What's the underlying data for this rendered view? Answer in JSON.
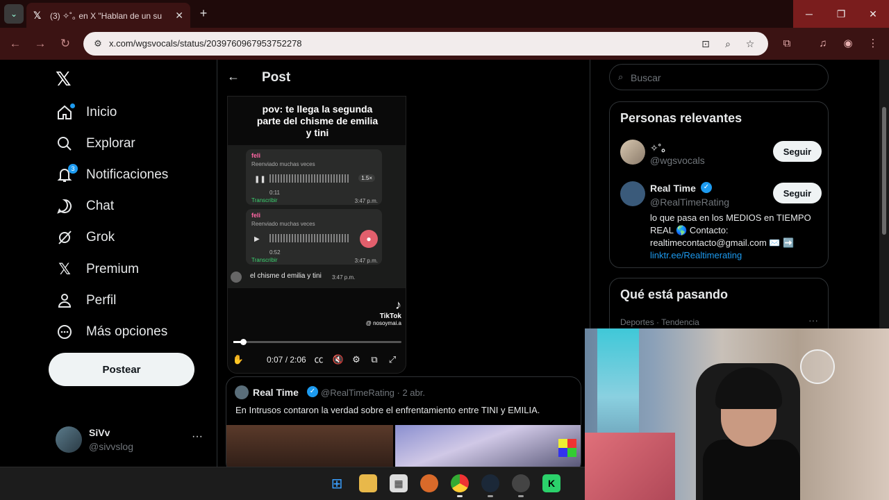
{
  "browser": {
    "tab_title": "(3) ✧˚｡ en X \"Hablan de un su",
    "url": "x.com/wgsvocals/status/2039760967953752278"
  },
  "nav": {
    "items": [
      {
        "label": "Inicio",
        "icon": "home-icon"
      },
      {
        "label": "Explorar",
        "icon": "search-icon"
      },
      {
        "label": "Notificaciones",
        "icon": "bell-icon",
        "badge": "3"
      },
      {
        "label": "Chat",
        "icon": "chat-icon"
      },
      {
        "label": "Grok",
        "icon": "grok-icon"
      },
      {
        "label": "Premium",
        "icon": "x-icon"
      },
      {
        "label": "Perfil",
        "icon": "person-icon"
      },
      {
        "label": "Más opciones",
        "icon": "more-circle-icon"
      }
    ],
    "post_button": "Postear",
    "account": {
      "name": "SiVv",
      "handle": "@sivvslog"
    }
  },
  "post": {
    "header_title": "Post",
    "video": {
      "caption": "pov: te llega la segunda parte del chisme de emilia y tini",
      "messages": [
        {
          "sender": "feli",
          "forwarded": "Reenviado muchas veces",
          "duration": "0:11",
          "speed": "1.5×",
          "transcribe": "Transcribir",
          "time": "3:47 p.m."
        },
        {
          "sender": "feli",
          "forwarded": "Reenviado muchas veces",
          "duration": "0:52",
          "transcribe": "Transcribir",
          "time": "3:47 p.m."
        }
      ],
      "last_message": {
        "text": "el chisme d emilia y tini",
        "time": "3:47 p.m."
      },
      "tiktok_label": "TikTok",
      "tiktok_user": "@ nosoymai.a",
      "time_display": "0:07 / 2:06",
      "progress": 0.056
    },
    "quote": {
      "name": "Real Time",
      "handle_date": "@RealTimeRating · 2 abr.",
      "text": "En Intrusos contaron la verdad sobre el enfrentamiento entre TINI y EMILIA."
    }
  },
  "sidebar": {
    "search_placeholder": "Buscar",
    "relevant_title": "Personas relevantes",
    "people": [
      {
        "name": "✧˚｡",
        "handle": "@wgsvocals",
        "follow": "Seguir"
      },
      {
        "name": "Real Time",
        "handle": "@RealTimeRating",
        "follow": "Seguir",
        "bio": "lo que pasa en los MEDIOS en TIEMPO REAL 🌎 Contacto: realtimecontacto@gmail.com ✉️ ➡️",
        "link": "linktr.ee/Realtimerating"
      }
    ],
    "trending_title": "Qué está pasando",
    "trend_meta": "Deportes · Tendencia"
  },
  "colors": {
    "accent": "#1d9bf0",
    "chrome": "#3b1313"
  }
}
